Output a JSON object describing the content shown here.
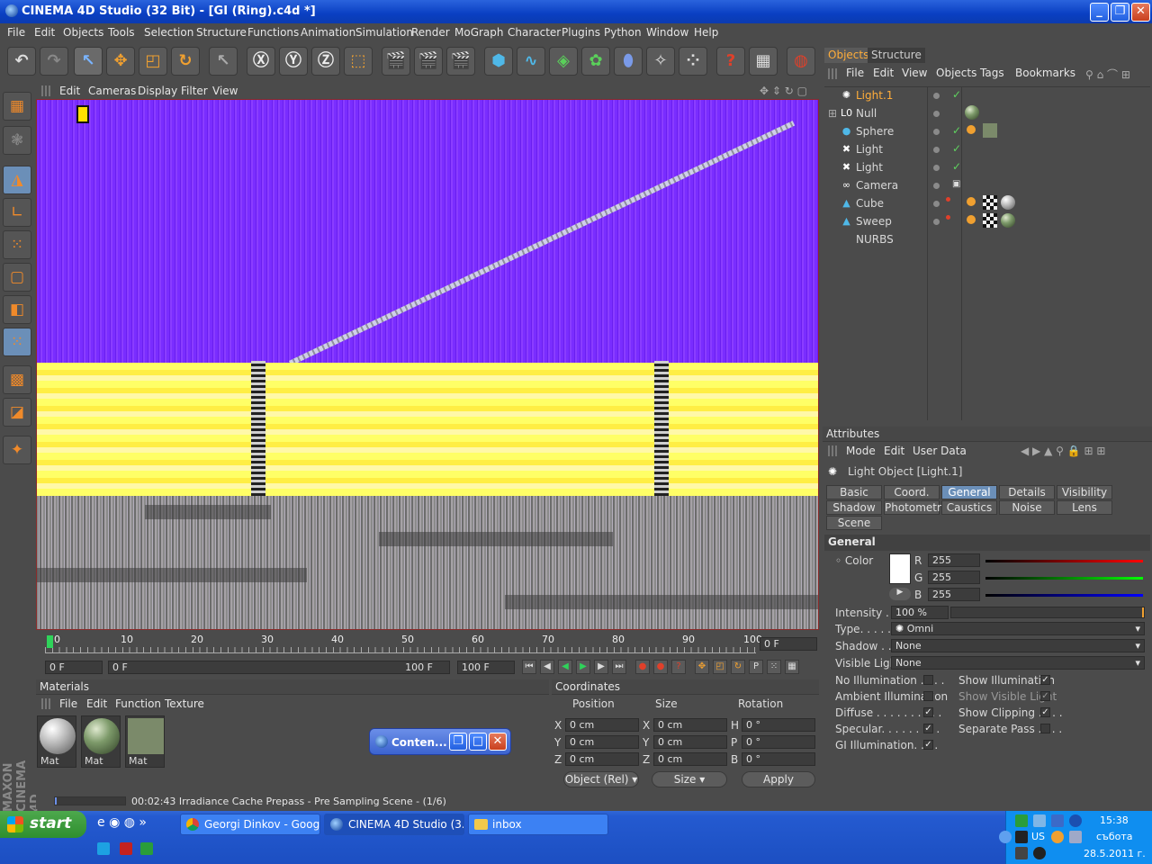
{
  "window": {
    "title": "CINEMA 4D Studio (32 Bit) - [GI (Ring).c4d *]"
  },
  "menubar": [
    "File",
    "Edit",
    "Objects",
    "Tools",
    "Selection",
    "Structure",
    "Functions",
    "Animation",
    "Simulation",
    "Render",
    "MoGraph",
    "Character",
    "Plugins",
    "Python",
    "Window",
    "Help"
  ],
  "viewport": {
    "menu": [
      "Edit",
      "Cameras",
      "Display",
      "Filter",
      "View"
    ]
  },
  "timeline": {
    "ticks": [
      "0",
      "10",
      "20",
      "30",
      "40",
      "50",
      "60",
      "70",
      "80",
      "90",
      "100"
    ],
    "frame_field": "0 F",
    "start": "0 F",
    "range_start": "0 F",
    "range_end": "100 F",
    "end": "100 F"
  },
  "materials": {
    "title": "Materials",
    "menu": [
      "File",
      "Edit",
      "Function",
      "Texture"
    ],
    "items": [
      {
        "label": "Mat",
        "color": "#bdbdbd"
      },
      {
        "label": "Mat",
        "color": "#7d9a6a"
      },
      {
        "label": "Mat",
        "color": "#7b8a6a"
      }
    ]
  },
  "coordinates": {
    "title": "Coordinates",
    "headers": [
      "Position",
      "Size",
      "Rotation"
    ],
    "rows": [
      {
        "axis": "X",
        "pos": "0 cm",
        "saxis": "X",
        "size": "0 cm",
        "raxis": "H",
        "rot": "0 °"
      },
      {
        "axis": "Y",
        "pos": "0 cm",
        "saxis": "Y",
        "size": "0 cm",
        "raxis": "P",
        "rot": "0 °"
      },
      {
        "axis": "Z",
        "pos": "0 cm",
        "saxis": "Z",
        "size": "0 cm",
        "raxis": "B",
        "rot": "0 °"
      }
    ],
    "mode": "Object (Rel)",
    "size_mode": "Size",
    "apply": "Apply"
  },
  "status": {
    "text": "00:02:43 Irradiance Cache Prepass - Pre Sampling Scene - (1/6)",
    "progress": 0.02
  },
  "floating": {
    "label": "Conten..."
  },
  "objects": {
    "tabs": [
      "Objects",
      "Structure"
    ],
    "menu": [
      "File",
      "Edit",
      "View",
      "Objects",
      "Tags",
      "Bookmarks"
    ],
    "items": [
      {
        "name": "Light.1",
        "icon": "light-icon",
        "glyph": "✺",
        "selected": true
      },
      {
        "name": "Null",
        "icon": "null-icon",
        "glyph": "L0"
      },
      {
        "name": "Sphere",
        "icon": "sphere-icon",
        "glyph": "●"
      },
      {
        "name": "Light",
        "icon": "light-icon",
        "glyph": "✖"
      },
      {
        "name": "Light",
        "icon": "light-icon",
        "glyph": "✖"
      },
      {
        "name": "Camera",
        "icon": "camera-icon",
        "glyph": "∞"
      },
      {
        "name": "Cube",
        "icon": "cube-icon",
        "glyph": "▲"
      },
      {
        "name": "Sweep NURBS",
        "icon": "sweep-icon",
        "glyph": "▲"
      }
    ]
  },
  "attributes": {
    "title": "Attributes",
    "menu": [
      "Mode",
      "Edit",
      "User Data"
    ],
    "object": "Light Object [Light.1]",
    "tabs": [
      [
        "Basic",
        "Coord.",
        "General",
        "Details",
        "Visibility"
      ],
      [
        "Shadow",
        "Photometric",
        "Caustics",
        "Noise",
        "Lens"
      ],
      [
        "Scene"
      ]
    ],
    "active_tab": "General",
    "section": "General",
    "color_label": "Color",
    "r": "255",
    "g": "255",
    "b": "255",
    "intensity_label": "Intensity . . .",
    "intensity": "100 %",
    "type_label": "Type. . . . . .",
    "type": "Omni",
    "shadow_label": "Shadow . . .",
    "shadow": "None",
    "visible_light_label": "Visible Light",
    "visible_light": "None",
    "checks_left": [
      {
        "label": "No Illumination . . . .",
        "checked": false
      },
      {
        "label": "Ambient Illumination",
        "checked": false
      },
      {
        "label": "Diffuse . . . . . . . . . .",
        "checked": true
      },
      {
        "label": "Specular. . . . . . . . .",
        "checked": true
      },
      {
        "label": "GI Illumination. . . .",
        "checked": true
      }
    ],
    "checks_right": [
      {
        "label": "Show Illumination",
        "checked": true
      },
      {
        "label": "Show Visible Light",
        "checked": true
      },
      {
        "label": "Show Clipping . . . .",
        "checked": true
      },
      {
        "label": "Separate Pass . . . .",
        "checked": false
      }
    ]
  },
  "taskbar": {
    "start": "start",
    "tasks": [
      "Georgi Dinkov - Googl...",
      "CINEMA 4D Studio (3...",
      "inbox"
    ],
    "time": "15:38",
    "day": "събота",
    "date": "28.5.2011 г.",
    "lang": "US"
  }
}
